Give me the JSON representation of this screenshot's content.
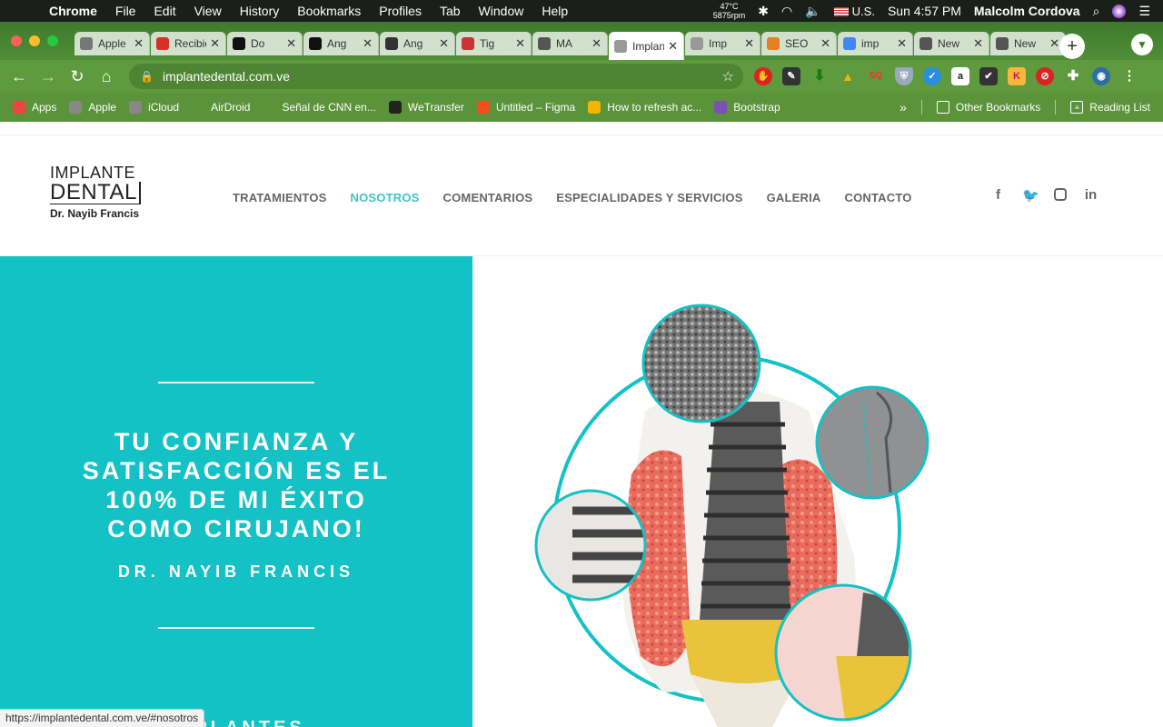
{
  "menubar": {
    "app": "Chrome",
    "items": [
      "File",
      "Edit",
      "View",
      "History",
      "Bookmarks",
      "Profiles",
      "Tab",
      "Window",
      "Help"
    ],
    "temp_line1": "47°C",
    "temp_line2": "5875rpm",
    "input_source": "U.S.",
    "clock": "Sun 4:57 PM",
    "user": "Malcolm Cordova"
  },
  "tabs": [
    {
      "title": "Apple",
      "icon": "apple-icon",
      "color": "#777"
    },
    {
      "title": "Recibidos",
      "icon": "gmail-icon",
      "color": "#d93025"
    },
    {
      "title": "Do",
      "icon": "medium-icon",
      "color": "#111"
    },
    {
      "title": "Ang",
      "icon": "medium-icon",
      "color": "#111"
    },
    {
      "title": "Ang",
      "icon": "x-circle-icon",
      "color": "#333"
    },
    {
      "title": "Tig",
      "icon": "planet-icon",
      "color": "#c33"
    },
    {
      "title": "MA",
      "icon": "github-icon",
      "color": "#555"
    },
    {
      "title": "Implante",
      "icon": "site-icon",
      "color": "#999",
      "active": true
    },
    {
      "title": "Imp",
      "icon": "site-icon",
      "color": "#999"
    },
    {
      "title": "SEO",
      "icon": "seo-icon",
      "color": "#e67e22"
    },
    {
      "title": "imp",
      "icon": "google-icon",
      "color": "#4285f4"
    },
    {
      "title": "New",
      "icon": "chrome-icon",
      "color": "#555"
    },
    {
      "title": "New",
      "icon": "chrome-icon",
      "color": "#555"
    }
  ],
  "toolbar": {
    "url": "implantedental.com.ve"
  },
  "bookmarks": [
    {
      "label": "Apps",
      "icon": "apps-grid-icon",
      "color": "#e44"
    },
    {
      "label": "Apple",
      "icon": "apple-icon",
      "color": "#888"
    },
    {
      "label": "iCloud",
      "icon": "apple-icon",
      "color": "#888"
    },
    {
      "label": "AirDroid",
      "icon": "globe-icon",
      "color": "#5a9339"
    },
    {
      "label": "Señal de CNN en...",
      "icon": "globe-icon",
      "color": "#5a9339"
    },
    {
      "label": "WeTransfer",
      "icon": "wetransfer-icon",
      "color": "#222"
    },
    {
      "label": "Untitled – Figma",
      "icon": "figma-icon",
      "color": "#f24e1e"
    },
    {
      "label": "How to refresh ac...",
      "icon": "folder-tag-icon",
      "color": "#f5b400"
    },
    {
      "label": "Bootstrap",
      "icon": "bootstrap-icon",
      "color": "#7952b3"
    }
  ],
  "bookmarks_right": {
    "other": "Other Bookmarks",
    "reading": "Reading List"
  },
  "site": {
    "logo_line1": "IMPLANTE",
    "logo_line2": "DENTAL",
    "logo_line3": "Dr. Nayib Francis",
    "nav": [
      "TRATAMIENTOS",
      "NOSOTROS",
      "COMENTARIOS",
      "ESPECIALIDADES Y SERVICIOS",
      "GALERIA",
      "CONTACTO"
    ],
    "nav_active_index": 1,
    "accent": "#14c1c4",
    "hero_quote_lines": [
      "TU CONFIANZA Y",
      "SATISFACCIÓN ES EL",
      "100% DE MI ÉXITO",
      "COMO CIRUJANO!"
    ],
    "hero_author": "DR. NAYIB FRANCIS",
    "hero_more": "IMPLANTES"
  },
  "status_url": "https://implantedental.com.ve/#nosotros"
}
